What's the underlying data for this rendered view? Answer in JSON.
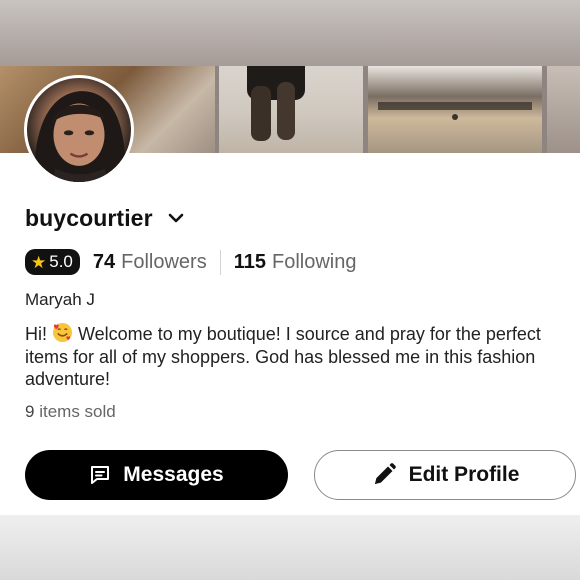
{
  "profile": {
    "username": "buycourtier",
    "rating": "5.0",
    "followers_count": "74",
    "followers_label": "Followers",
    "following_count": "115",
    "following_label": "Following",
    "display_name": "Maryah J",
    "bio_prefix": "Hi! ",
    "bio_emoji": "smiling-face-with-hearts-icon",
    "bio_text": " Welcome to my boutique! I source and pray for the perfect items for all of my shoppers. God has blessed me in this fashion adventure!",
    "items_sold_count": "9",
    "items_sold_label": "items sold"
  },
  "actions": {
    "messages_label": "Messages",
    "edit_profile_label": "Edit Profile"
  },
  "icons": {
    "username_menu": "chevron-down-icon",
    "rating": "star-icon",
    "messages": "message-bubble-icon",
    "edit": "pencil-icon"
  },
  "colors": {
    "primary_button_bg": "#000000",
    "rating_badge_bg": "#111111",
    "star": "#f5c518",
    "secondary_text": "#666666",
    "outline_button_border": "#8a8a8a"
  }
}
